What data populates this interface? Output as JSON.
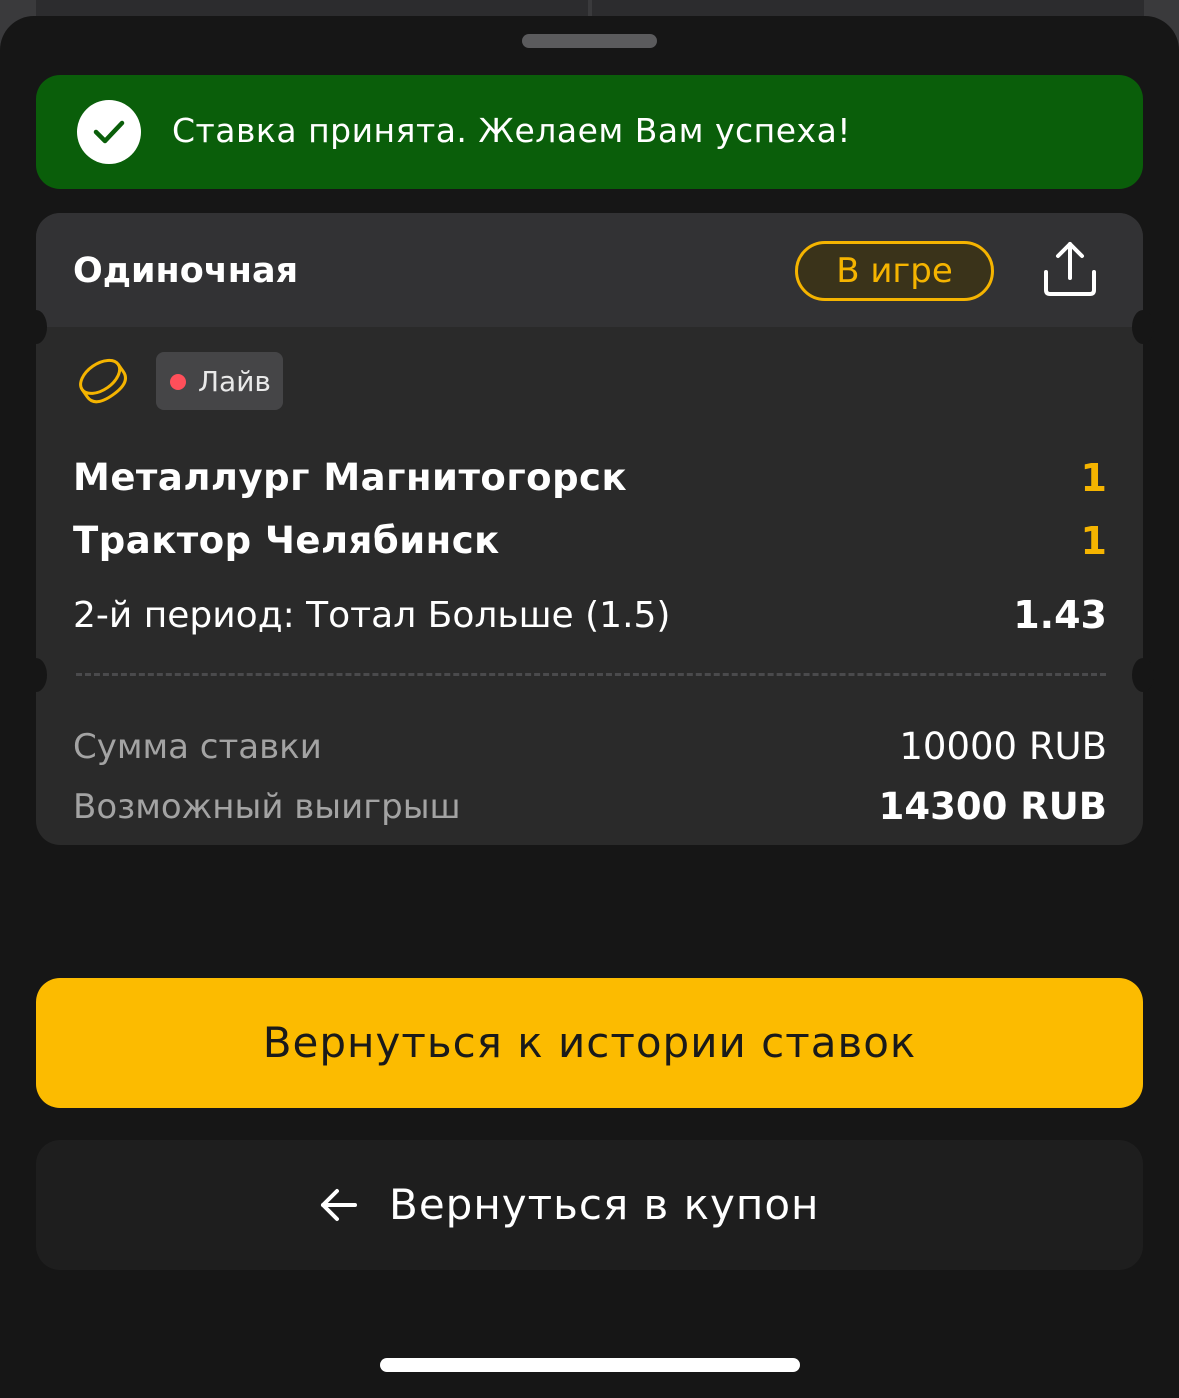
{
  "toast": {
    "message": "Ставка принята. Желаем Вам успеха!",
    "icon": "check-icon"
  },
  "bet": {
    "type": "Одиночная",
    "status": "В игре",
    "live_label": "Лайв",
    "teams": [
      {
        "name": "Металлург Магнитогорск",
        "score": "1"
      },
      {
        "name": "Трактор Челябинск",
        "score": "1"
      }
    ],
    "market": "2-й период: Тотал Больше (1.5)",
    "odds": "1.43",
    "stake_label": "Сумма ставки",
    "stake_value": "10000 RUB",
    "win_label": "Возможный выигрыш",
    "win_value": "14300 RUB"
  },
  "buttons": {
    "history": "Вернуться к истории ставок",
    "coupon": "Вернуться в купон"
  },
  "colors": {
    "accent": "#fcbb00",
    "success": "#0a5e0a",
    "live_dot": "#ff4f5a"
  }
}
